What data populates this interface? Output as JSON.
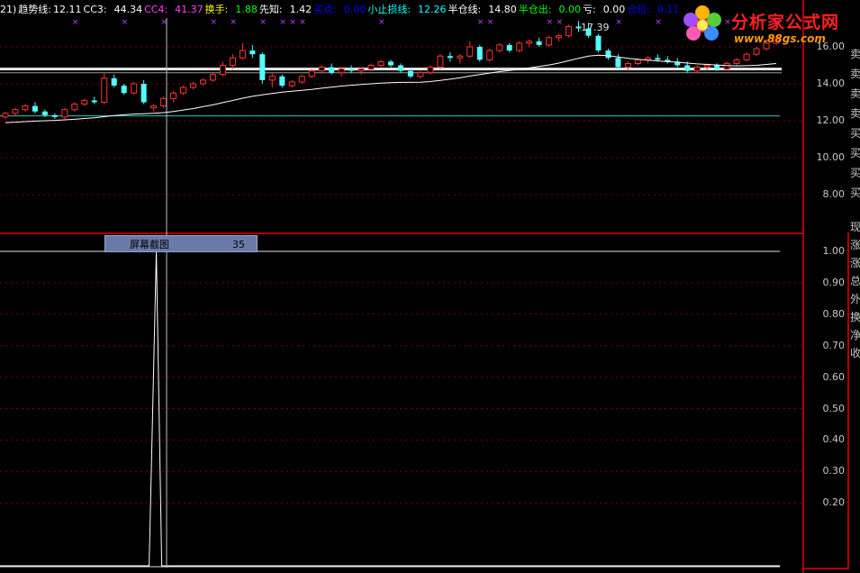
{
  "header": {
    "items": [
      {
        "label": "21)",
        "color": "#ffffff"
      },
      {
        "label": "趋势线:",
        "color": "#ffffff"
      },
      {
        "label": "12.11",
        "color": "#ffffff"
      },
      {
        "label": "CC3:",
        "color": "#ffffff"
      },
      {
        "label": "44.34",
        "color": "#ffffff"
      },
      {
        "label": "CC4:",
        "color": "#ff40ff"
      },
      {
        "label": "41.37",
        "color": "#ff40ff"
      },
      {
        "label": "换手:",
        "color": "#ffff00"
      },
      {
        "label": "1.88",
        "color": "#00ff00"
      },
      {
        "label": "先知:",
        "color": "#ffffff"
      },
      {
        "label": "1.42",
        "color": "#ffffff"
      },
      {
        "label": "买点:",
        "color": "#0000ff"
      },
      {
        "label": "0.00",
        "color": "#0000ff"
      },
      {
        "label": "小止损线:",
        "color": "#00ffff"
      },
      {
        "label": "12.26",
        "color": "#00ffff"
      },
      {
        "label": "半仓线:",
        "color": "#ffffff"
      },
      {
        "label": "14.80",
        "color": "#ffffff"
      },
      {
        "label": "半仓出:",
        "color": "#00ff00"
      },
      {
        "label": "0.00",
        "color": "#00ff00"
      },
      {
        "label": "亏:",
        "color": "#ffffff"
      },
      {
        "label": "0.00",
        "color": "#ffffff"
      },
      {
        "label": "仓位:",
        "color": "#0000ff"
      },
      {
        "label": "0.11",
        "color": "#0000ff"
      }
    ]
  },
  "price_axis": {
    "ticks": [
      "16.00",
      "14.00",
      "12.00",
      "10.00",
      "8.00"
    ]
  },
  "indicator_axis": {
    "ticks": [
      "1.00",
      "0.90",
      "0.80",
      "0.70",
      "0.60",
      "0.50",
      "0.40",
      "0.30",
      "0.20"
    ]
  },
  "tooltip": {
    "label": "屏幕截图",
    "value": "35"
  },
  "high_marker": "17.39",
  "side_panel": {
    "chars": [
      "卖",
      "卖",
      "卖",
      "卖",
      "买",
      "买",
      "买",
      "买",
      "现",
      "涨",
      "涨",
      "总",
      "外",
      "换",
      "净",
      "收"
    ]
  },
  "logo": {
    "title": "分析家公式网",
    "url": "www.88gs.com"
  },
  "colors": {
    "up": "#ff3232",
    "down": "#54fcfc",
    "ma": "#ffffff",
    "support": "#40c0c0",
    "border": "#b00000"
  },
  "chart_data": {
    "type": "line",
    "candles": [
      [
        12.2,
        12.5,
        12.1,
        12.4
      ],
      [
        12.4,
        12.7,
        12.3,
        12.6
      ],
      [
        12.6,
        12.9,
        12.5,
        12.8
      ],
      [
        12.8,
        13.0,
        12.4,
        12.5
      ],
      [
        12.5,
        12.6,
        12.2,
        12.3
      ],
      [
        12.3,
        12.4,
        12.1,
        12.2
      ],
      [
        12.2,
        12.7,
        12.1,
        12.6
      ],
      [
        12.6,
        13.0,
        12.5,
        12.9
      ],
      [
        12.9,
        13.2,
        12.8,
        13.1
      ],
      [
        13.1,
        13.3,
        12.9,
        13.0
      ],
      [
        13.0,
        14.6,
        12.9,
        14.3
      ],
      [
        14.3,
        14.5,
        13.8,
        13.9
      ],
      [
        13.9,
        14.0,
        13.4,
        13.5
      ],
      [
        13.5,
        14.1,
        13.4,
        14.0
      ],
      [
        14.0,
        14.2,
        12.9,
        13.0
      ],
      [
        12.7,
        12.9,
        12.5,
        12.8
      ],
      [
        12.8,
        13.3,
        12.7,
        13.2
      ],
      [
        13.2,
        13.6,
        13.0,
        13.5
      ],
      [
        13.5,
        13.9,
        13.4,
        13.8
      ],
      [
        13.8,
        14.1,
        13.7,
        14.0
      ],
      [
        14.0,
        14.3,
        13.9,
        14.2
      ],
      [
        14.2,
        14.6,
        14.1,
        14.5
      ],
      [
        14.5,
        15.2,
        14.4,
        15.0
      ],
      [
        15.0,
        15.6,
        14.8,
        15.4
      ],
      [
        15.4,
        16.2,
        15.3,
        15.8
      ],
      [
        15.8,
        16.1,
        15.4,
        15.6
      ],
      [
        15.6,
        15.7,
        14.0,
        14.2
      ],
      [
        14.2,
        14.6,
        13.8,
        14.4
      ],
      [
        14.4,
        14.5,
        13.8,
        13.9
      ],
      [
        13.9,
        14.2,
        13.8,
        14.1
      ],
      [
        14.1,
        14.5,
        14.0,
        14.4
      ],
      [
        14.4,
        14.8,
        14.3,
        14.7
      ],
      [
        14.7,
        15.0,
        14.6,
        14.9
      ],
      [
        14.9,
        15.1,
        14.5,
        14.6
      ],
      [
        14.6,
        14.9,
        14.4,
        14.8
      ],
      [
        14.8,
        15.0,
        14.6,
        14.7
      ],
      [
        14.7,
        14.9,
        14.5,
        14.8
      ],
      [
        14.8,
        15.1,
        14.7,
        15.0
      ],
      [
        15.0,
        15.3,
        14.9,
        15.2
      ],
      [
        15.2,
        15.3,
        14.9,
        15.0
      ],
      [
        15.0,
        15.1,
        14.6,
        14.7
      ],
      [
        14.7,
        14.8,
        14.3,
        14.4
      ],
      [
        14.4,
        14.7,
        14.3,
        14.6
      ],
      [
        14.6,
        15.0,
        14.5,
        14.9
      ],
      [
        14.9,
        15.6,
        14.8,
        15.5
      ],
      [
        15.5,
        15.7,
        15.2,
        15.4
      ],
      [
        15.4,
        15.6,
        15.1,
        15.5
      ],
      [
        15.5,
        16.3,
        15.4,
        16.0
      ],
      [
        16.0,
        16.1,
        15.2,
        15.3
      ],
      [
        15.3,
        15.9,
        15.2,
        15.8
      ],
      [
        15.8,
        16.2,
        15.7,
        16.1
      ],
      [
        16.1,
        16.2,
        15.7,
        15.8
      ],
      [
        15.8,
        16.3,
        15.7,
        16.2
      ],
      [
        16.2,
        16.4,
        16.0,
        16.3
      ],
      [
        16.3,
        16.5,
        16.0,
        16.1
      ],
      [
        16.1,
        16.6,
        16.0,
        16.5
      ],
      [
        16.5,
        16.7,
        16.3,
        16.6
      ],
      [
        16.6,
        17.2,
        16.5,
        17.1
      ],
      [
        17.1,
        17.4,
        16.8,
        17.0
      ],
      [
        17.0,
        17.3,
        16.5,
        16.6
      ],
      [
        16.6,
        16.7,
        15.7,
        15.8
      ],
      [
        15.8,
        15.9,
        15.3,
        15.4
      ],
      [
        15.4,
        15.6,
        14.8,
        14.9
      ],
      [
        14.9,
        15.2,
        14.7,
        15.1
      ],
      [
        15.1,
        15.4,
        15.0,
        15.3
      ],
      [
        15.3,
        15.5,
        15.1,
        15.4
      ],
      [
        15.4,
        15.6,
        15.2,
        15.3
      ],
      [
        15.3,
        15.5,
        15.1,
        15.2
      ],
      [
        15.2,
        15.4,
        14.9,
        15.0
      ],
      [
        15.0,
        15.2,
        14.6,
        14.7
      ],
      [
        14.7,
        15.0,
        14.6,
        14.9
      ],
      [
        14.9,
        15.1,
        14.7,
        15.0
      ],
      [
        15.0,
        15.1,
        14.7,
        14.8
      ],
      [
        14.8,
        15.2,
        14.7,
        15.1
      ],
      [
        15.1,
        15.4,
        15.0,
        15.3
      ],
      [
        15.3,
        15.7,
        15.2,
        15.6
      ],
      [
        15.6,
        16.0,
        15.5,
        15.9
      ],
      [
        15.9,
        16.4,
        15.8,
        16.2
      ],
      [
        16.2,
        16.6,
        16.1,
        16.5
      ]
    ],
    "ma": [
      11.9,
      11.92,
      11.95,
      11.98,
      12.0,
      12.02,
      12.05,
      12.08,
      12.12,
      12.16,
      12.22,
      12.28,
      12.32,
      12.36,
      12.38,
      12.4,
      12.44,
      12.5,
      12.58,
      12.66,
      12.76,
      12.86,
      12.98,
      13.1,
      13.22,
      13.32,
      13.4,
      13.48,
      13.55,
      13.6,
      13.65,
      13.7,
      13.76,
      13.82,
      13.88,
      13.92,
      13.96,
      14.0,
      14.04,
      14.06,
      14.08,
      14.08,
      14.09,
      14.12,
      14.18,
      14.25,
      14.32,
      14.42,
      14.5,
      14.58,
      14.66,
      14.72,
      14.78,
      14.86,
      14.94,
      15.02,
      15.12,
      15.25,
      15.38,
      15.5,
      15.55,
      15.52,
      15.45,
      15.38,
      15.32,
      15.28,
      15.24,
      15.2,
      15.17,
      15.12,
      15.08,
      15.05,
      15.02,
      14.99,
      14.97,
      14.98,
      15.0,
      15.05,
      15.1
    ],
    "support_level": 12.26,
    "halfpos_level": 14.8,
    "indicator": {
      "spike_index": 15,
      "spike_value": 1.0,
      "baseline": 0.0
    }
  }
}
